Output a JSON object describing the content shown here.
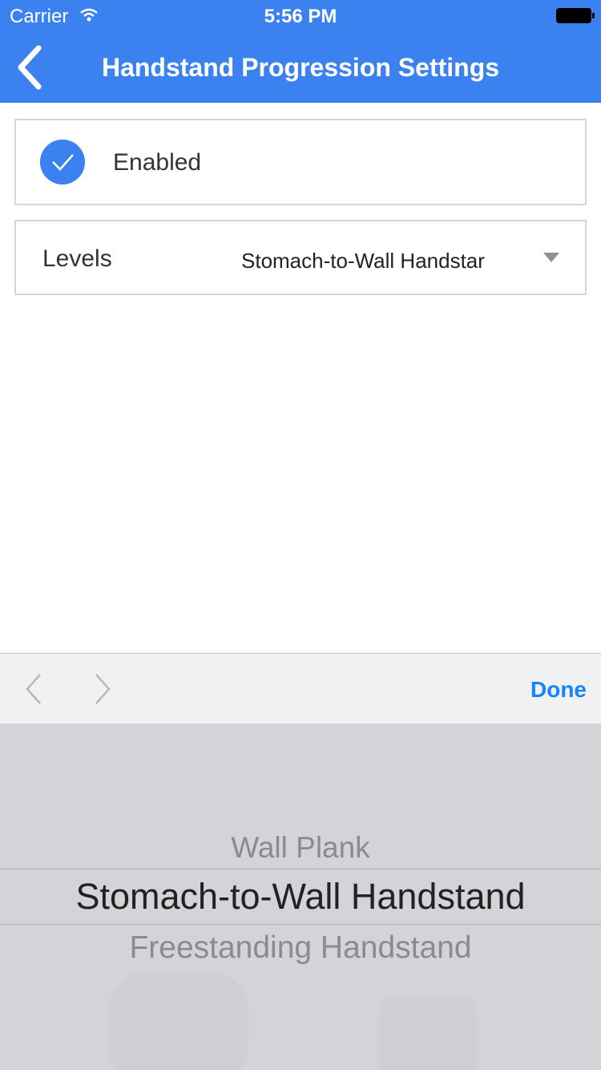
{
  "status_bar": {
    "carrier": "Carrier",
    "time": "5:56 PM",
    "icons": [
      "wifi-icon",
      "battery-icon"
    ]
  },
  "nav": {
    "title": "Handstand Progression Settings",
    "back_icon": "chevron-left-icon"
  },
  "settings": {
    "enabled": {
      "label": "Enabled",
      "checked": true
    },
    "levels": {
      "label": "Levels",
      "value": "Stomach-to-Wall Handstar"
    }
  },
  "toolbar": {
    "prev_icon": "chevron-left-icon",
    "next_icon": "chevron-right-icon",
    "done_label": "Done"
  },
  "picker": {
    "items": [
      "Wall Plank",
      "Stomach-to-Wall Handstand",
      "Freestanding Handstand"
    ],
    "selected": "Stomach-to-Wall Handstand"
  },
  "colors": {
    "header": "#3b82f0",
    "done": "#1683ff",
    "picker_bg": "#d2d4d8"
  }
}
